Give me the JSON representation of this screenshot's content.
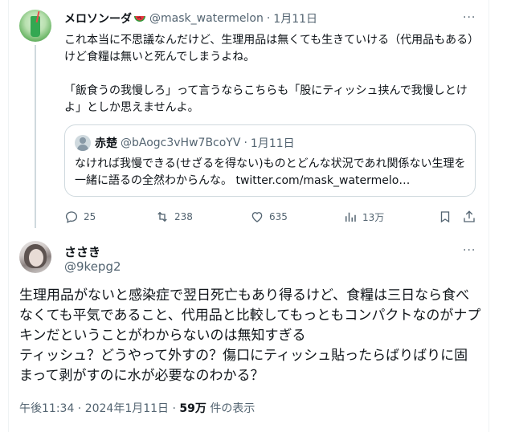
{
  "reply_tweet": {
    "author_name": "メロソンーダ",
    "author_emoji": "watermelon-emoji",
    "handle": "@mask_watermelon",
    "separator": "·",
    "date": "1月11日",
    "more": "···",
    "paragraphs": [
      "これ本当に不思議なんだけど、生理用品は無くても生きていける（代用品もある）けど食糧は無いと死んでしまうよね。",
      "「飯食うの我慢しろ」って言うならこちらも「股にティッシュ挟んで我慢しとけよ」としか思えませんよ。"
    ],
    "quote": {
      "author_name": "赤楚",
      "handle": "@bAogc3vHw7BcoYV",
      "separator": "·",
      "date": "1月11日",
      "text": "なければ我慢できる(せざるを得ない)ものとどんな状況であれ関係ない生理を一緒に語るの全然わからんな。 twitter.com/mask_watermelo…"
    },
    "actions": {
      "replies": "25",
      "reposts": "238",
      "likes": "635",
      "views": "13万"
    }
  },
  "main_tweet": {
    "author_name": "ささき",
    "handle": "@9kepg2",
    "more": "···",
    "lines": [
      "生理用品がないと感染症で翌日死亡もあり得るけど、食糧は三日なら食べなくても平気であること、代用品と比較してもっともコンパクトなのがナプキンだということがわからないのは無知すぎる",
      "ティッシュ？どうやって外すの？傷口にティッシュ貼ったらばりばりに固まって剥がすのに水が必要なのわかる？"
    ],
    "timestamp": "午後11:34 · 2024年1月11日 · ",
    "views_count": "59万",
    "views_label": " 件の表示"
  },
  "colors": {
    "text": "#0f1419",
    "secondary": "#536471",
    "border": "#cfd9de"
  }
}
